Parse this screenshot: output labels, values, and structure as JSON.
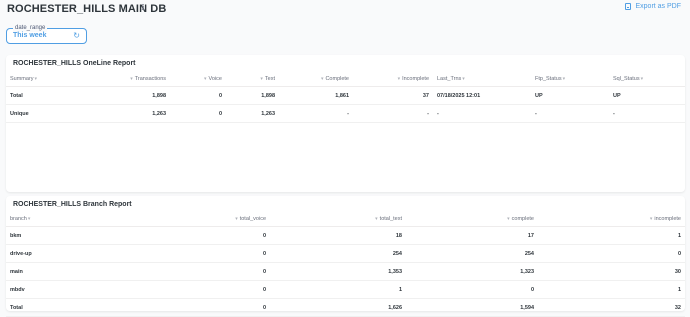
{
  "header": {
    "title": "ROCHESTER_HILLS MAIN DB",
    "export_label": "Export as PDF"
  },
  "filter": {
    "label": "date_range",
    "value": "This week"
  },
  "online_report": {
    "title": "ROCHESTER_HILLS OneLine Report",
    "columns": [
      "Summary",
      "Transactions",
      "Voice",
      "Text",
      "Complete",
      "Incomplete",
      "Last_Trns",
      "Ftp_Status",
      "Sql_Status"
    ],
    "rows": [
      [
        "Total",
        "1,898",
        "0",
        "1,898",
        "1,861",
        "37",
        "07/18/2025 12:01",
        "UP",
        "UP"
      ],
      [
        "Unique",
        "1,263",
        "0",
        "1,263",
        "-",
        "-",
        "-",
        "-",
        "-"
      ]
    ]
  },
  "branch_report": {
    "title": "ROCHESTER_HILLS Branch Report",
    "columns": [
      "branch",
      "total_voice",
      "total_text",
      "complete",
      "incomplete"
    ],
    "rows": [
      [
        "bkm",
        "0",
        "18",
        "17",
        "1"
      ],
      [
        "drive-up",
        "0",
        "254",
        "254",
        "0"
      ],
      [
        "main",
        "0",
        "1,353",
        "1,323",
        "30"
      ],
      [
        "mbdv",
        "0",
        "1",
        "0",
        "1"
      ],
      [
        "Total",
        "0",
        "1,626",
        "1,594",
        "32"
      ]
    ]
  },
  "colors": {
    "accent": "#509ee3",
    "text_dark": "#2e353b",
    "text_muted": "#696e7b"
  },
  "icons": {
    "info": "info-icon",
    "export": "pdf-icon",
    "reset": "reset-icon",
    "sort": "caret-down-icon"
  }
}
